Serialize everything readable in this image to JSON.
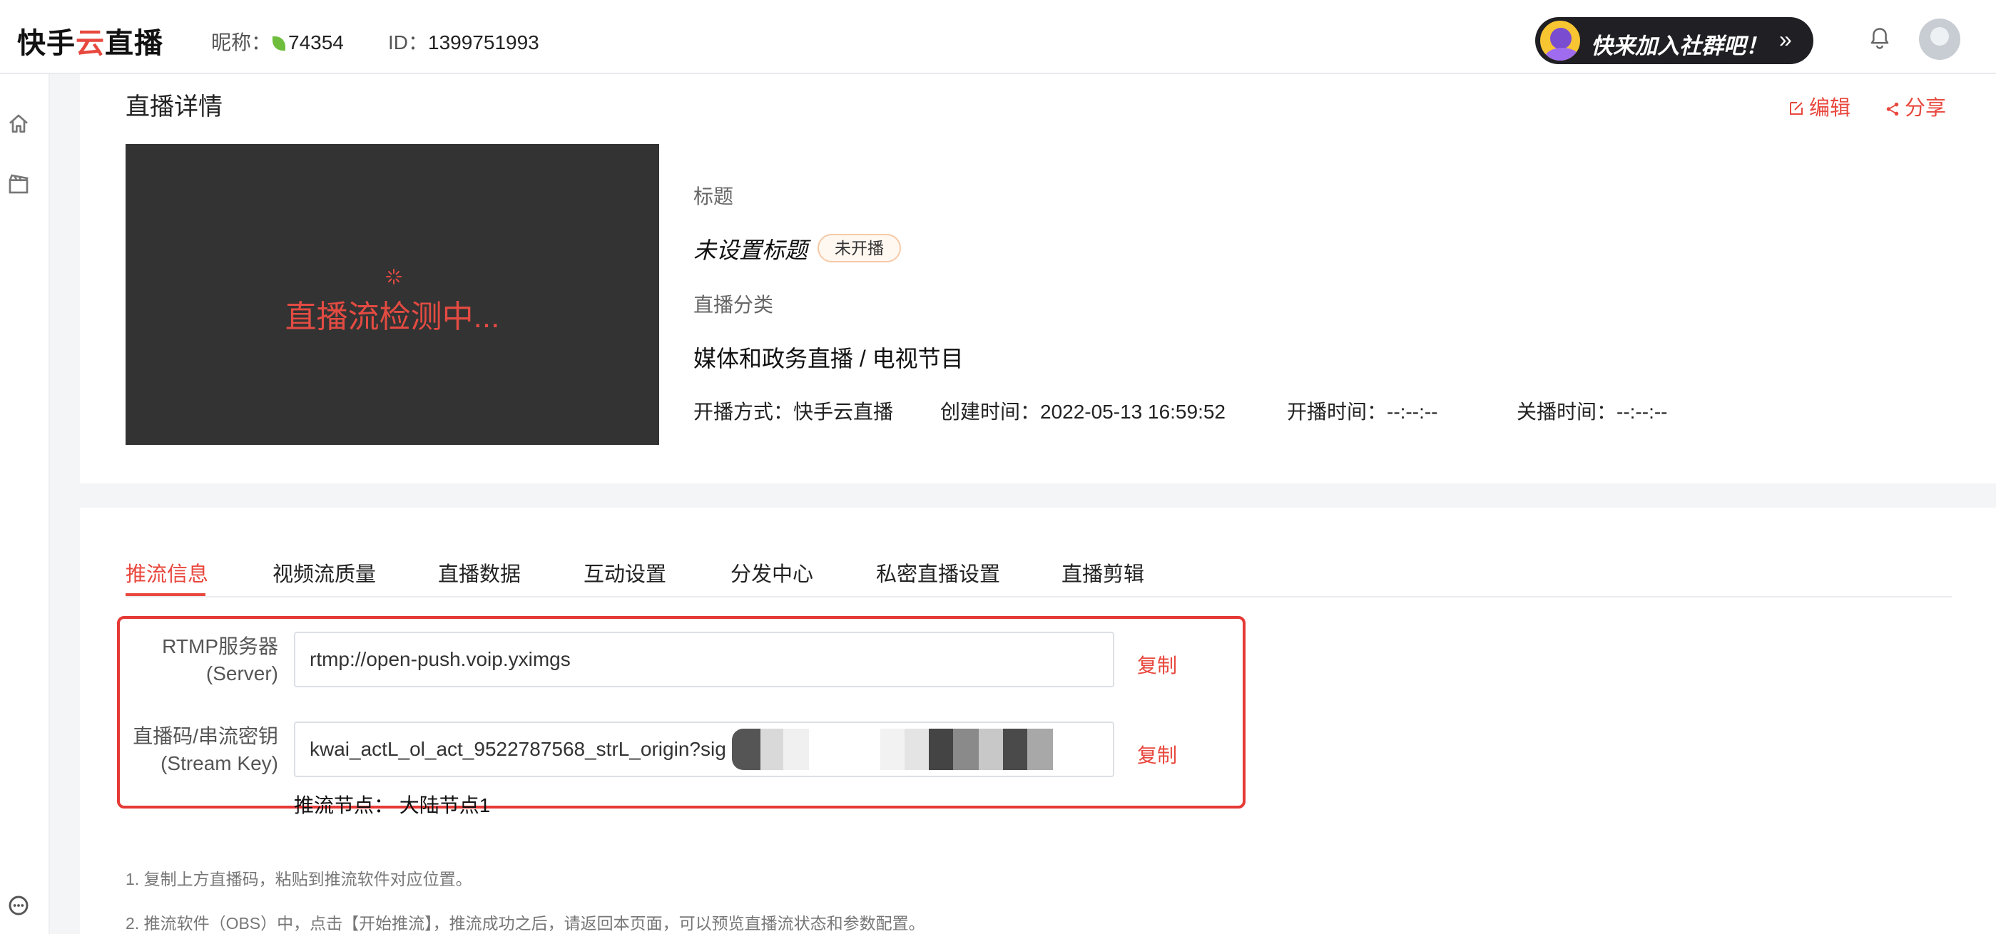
{
  "header": {
    "brand": {
      "prefix": "快手",
      "dot": "云",
      "suffix": "直播"
    },
    "nickname_label": "昵称：",
    "nickname": "74354",
    "id_label": "ID：",
    "id": "1399751993",
    "join_banner": "快来加入社群吧！",
    "join_arrow": "»"
  },
  "detail": {
    "page_title": "直播详情",
    "edit_label": "编辑",
    "share_label": "分享",
    "player_status": "直播流检测中...",
    "title_label": "标题",
    "title_value": "未设置标题",
    "status_badge": "未开播",
    "category_label": "直播分类",
    "category_value": "媒体和政务直播 / 电视节目",
    "meta": {
      "method": "开播方式：快手云直播",
      "created": "创建时间：2022-05-13 16:59:52",
      "start": "开播时间：--:--:--",
      "end": "关播时间：--:--:--"
    }
  },
  "tabs": [
    {
      "label": "推流信息",
      "active": true
    },
    {
      "label": "视频流质量"
    },
    {
      "label": "直播数据"
    },
    {
      "label": "互动设置"
    },
    {
      "label": "分发中心"
    },
    {
      "label": "私密直播设置"
    },
    {
      "label": "直播剪辑"
    }
  ],
  "push": {
    "server_label_1": "RTMP服务器",
    "server_label_2": "(Server)",
    "server_value": "rtmp://open-push.voip.yximgs",
    "key_label_1": "直播码/串流密钥",
    "key_label_2": "(Stream Key)",
    "key_value": "kwai_actL_ol_act_9522787568_strL_origin?sig",
    "copy_label": "复制",
    "node": "推流节点：  大陆节点1"
  },
  "tips": [
    "1. 复制上方直播码，粘贴到推流软件对应位置。",
    "2. 推流软件（OBS）中，点击【开始推流】，推流成功之后，请返回本页面，可以预览直播流状态和参数配置。"
  ],
  "colors": {
    "accent": "#e8483e",
    "player_bg": "#333333",
    "highlight": "#e53935"
  }
}
